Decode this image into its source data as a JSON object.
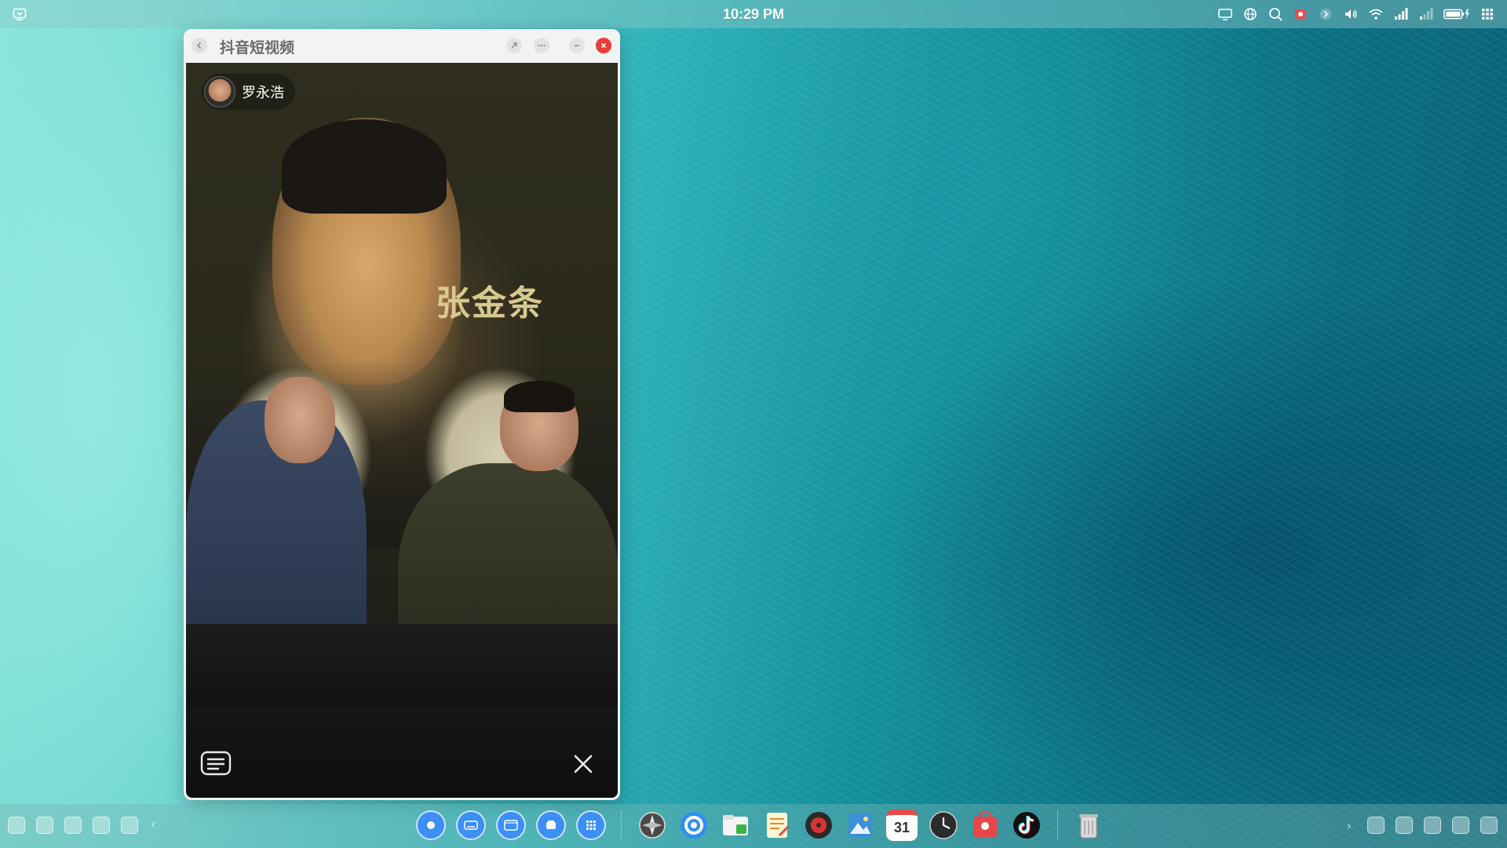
{
  "topbar": {
    "time": "10:29 PM",
    "left_icon": "screenshot-icon",
    "tray_icons": [
      "display-icon",
      "network-globe-icon",
      "search-icon",
      "record-icon",
      "chevron-right-icon",
      "volume-icon",
      "wifi-icon",
      "signal-icon",
      "signal-weak-icon",
      "battery-charging-icon",
      "app-grid-icon"
    ]
  },
  "window": {
    "title": "抖音短视频",
    "buttons": [
      "back-icon",
      "share-icon",
      "more-icon",
      "minimize-icon",
      "close-icon"
    ]
  },
  "video": {
    "author_name": "罗永浩",
    "poster_text": "张金条"
  },
  "dock": {
    "left_icons": [
      "gear-icon",
      "globe-icon",
      "monitor-icon",
      "toggle-icon",
      "basket-icon"
    ],
    "center_buttons": [
      "launcher-icon",
      "keyboard-icon",
      "window-icon",
      "multitask-icon",
      "app-grid-icon"
    ],
    "apps": [
      "system-monitor",
      "browser",
      "file-manager",
      "text-editor",
      "music-player",
      "image-viewer",
      "calendar",
      "clock",
      "app-store",
      "douyin",
      "trash"
    ],
    "calendar_day": "31",
    "right_icons": [
      "chevron-right-icon",
      "image-icon",
      "folder-icon",
      "clipboard-icon",
      "list-icon",
      "window-icon"
    ]
  },
  "colors": {
    "close_red": "#ee3b3b",
    "dock_blue": "#3b8ff5",
    "poster_text": "#d8c98e"
  }
}
